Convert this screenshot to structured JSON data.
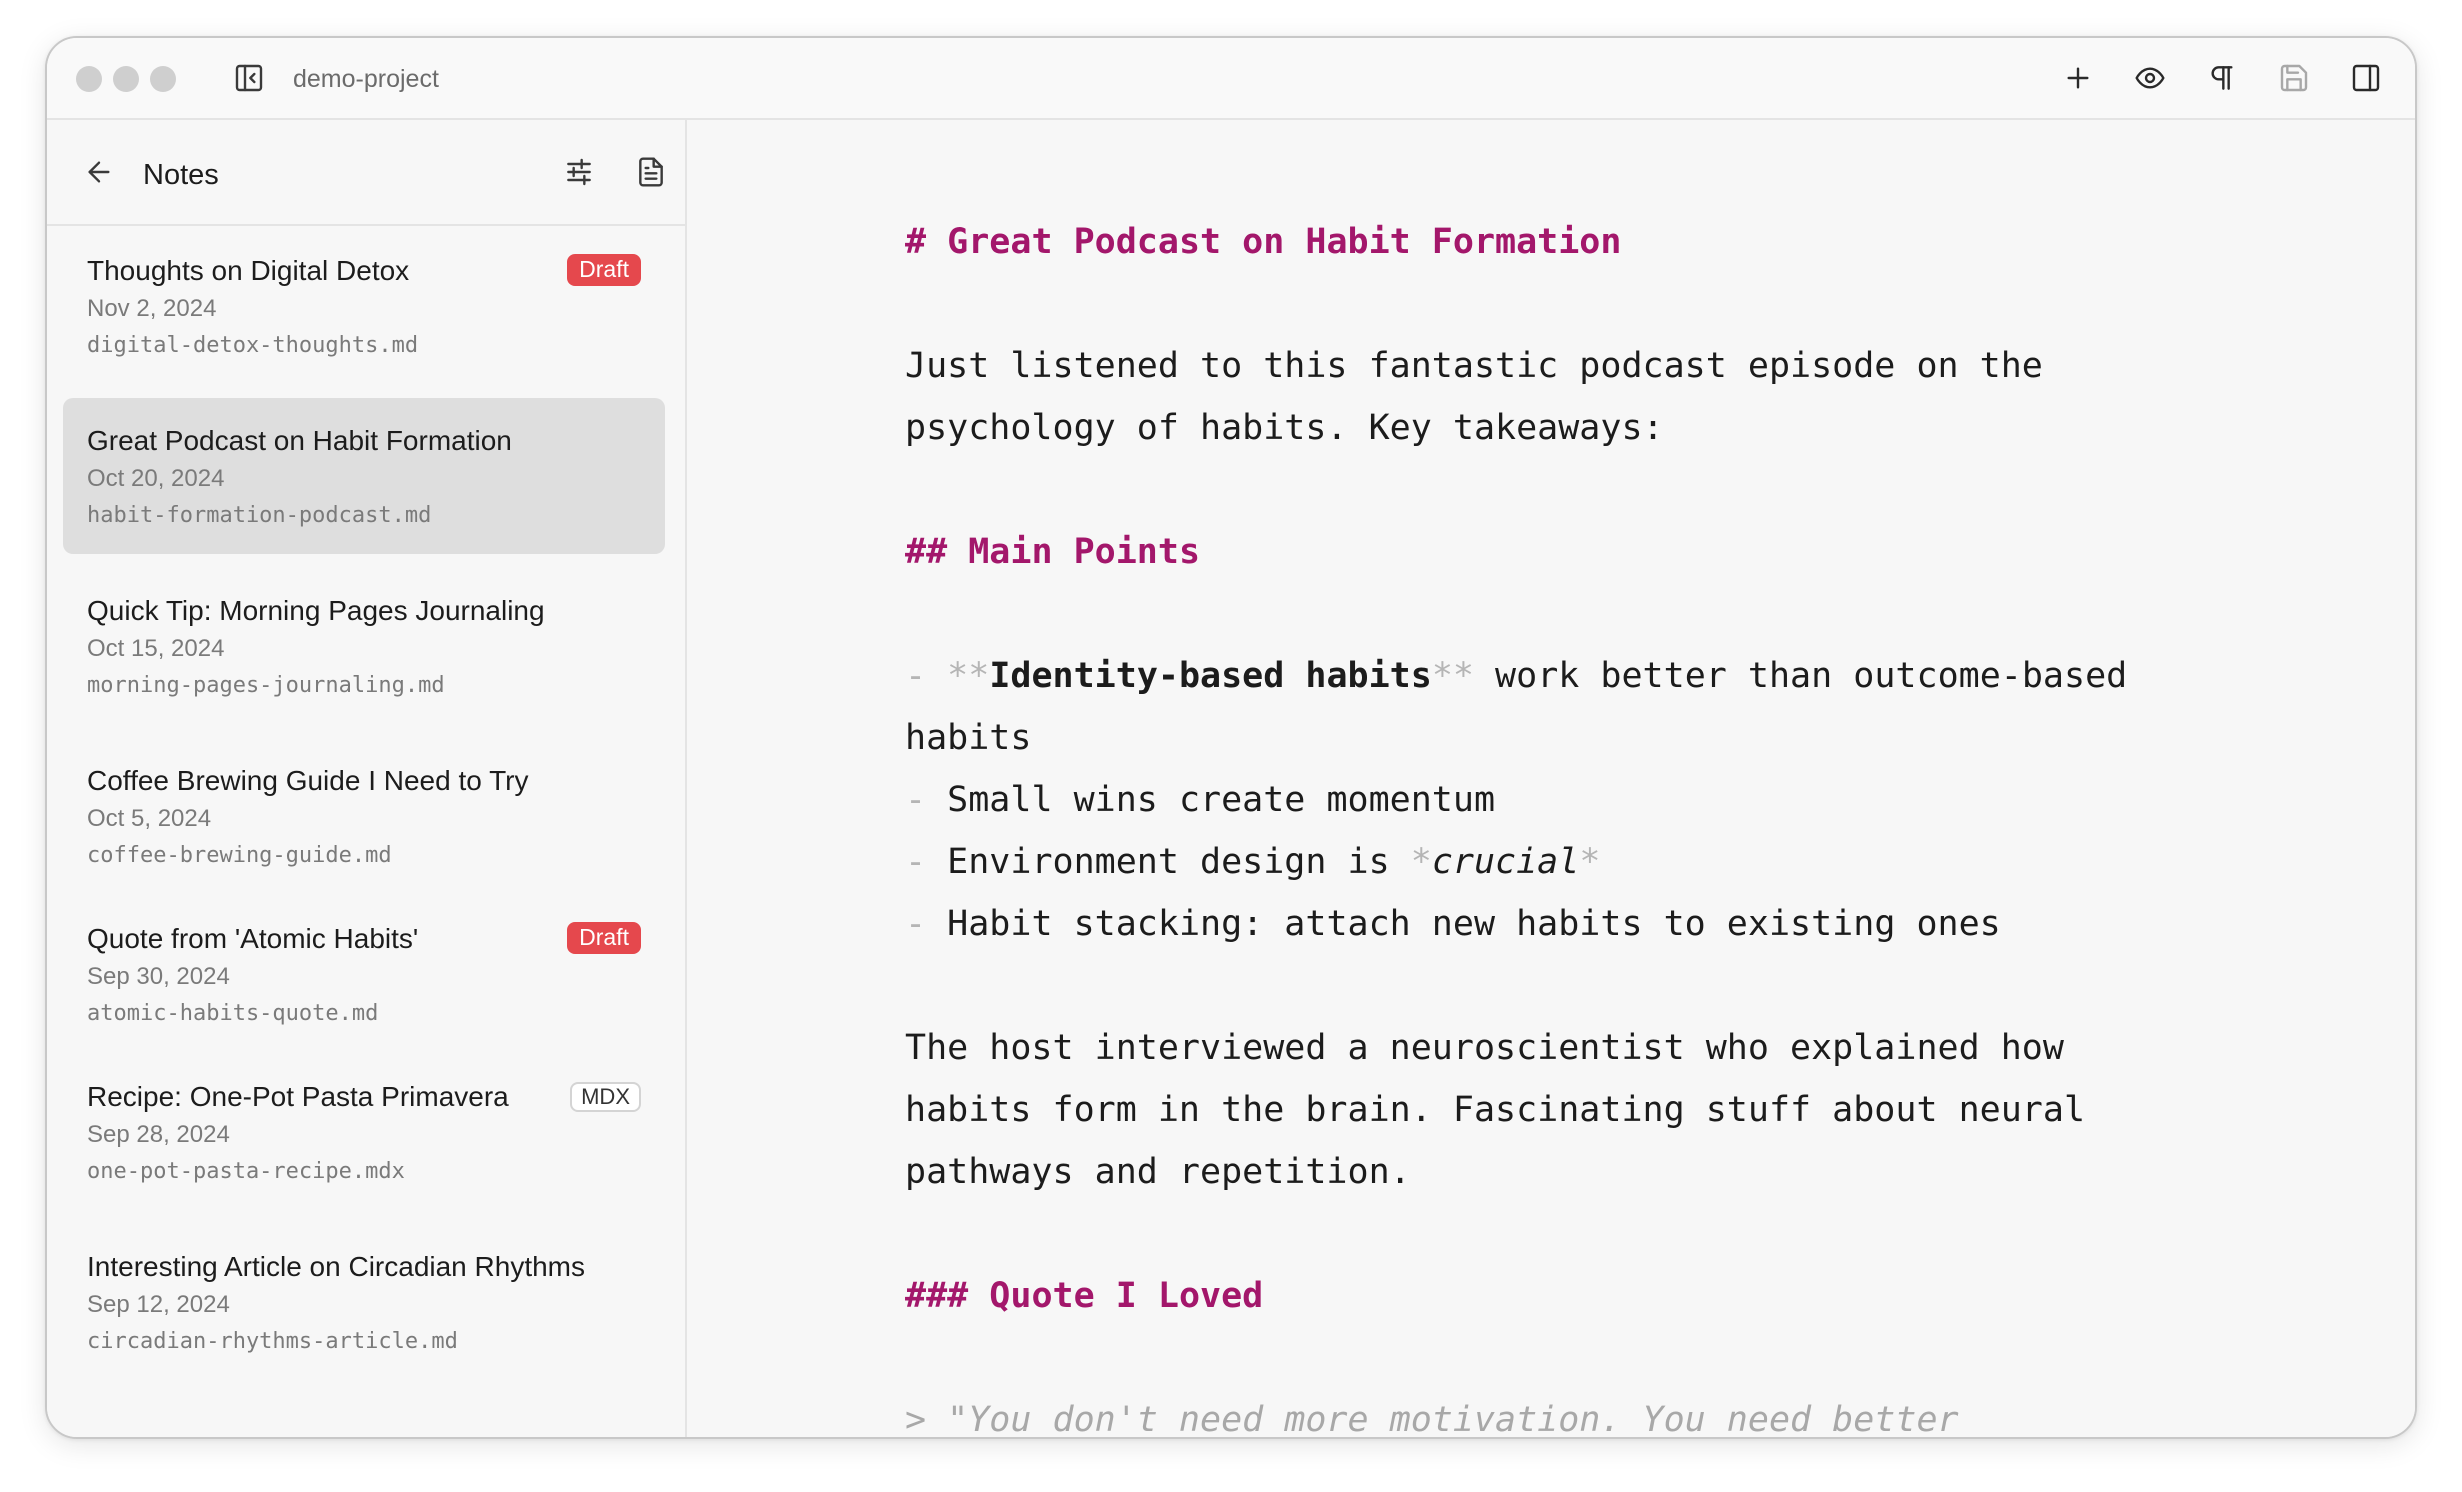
{
  "titlebar": {
    "project_name": "demo-project",
    "icons": [
      "sidebar-collapse-icon",
      "plus-icon",
      "eye-icon",
      "pilcrow-icon",
      "save-icon",
      "panel-right-icon"
    ]
  },
  "sidebar": {
    "title": "Notes",
    "icons": [
      "arrow-left-icon",
      "sliders-icon",
      "file-text-icon"
    ],
    "notes": [
      {
        "title": "Thoughts on Digital Detox",
        "date": "Nov 2, 2024",
        "file": "digital-detox-thoughts.md",
        "badge": "Draft"
      },
      {
        "title": "Great Podcast on Habit Formation",
        "date": "Oct 20, 2024",
        "file": "habit-formation-podcast.md",
        "badge": ""
      },
      {
        "title": "Quick Tip: Morning Pages Journaling",
        "date": "Oct 15, 2024",
        "file": "morning-pages-journaling.md",
        "badge": ""
      },
      {
        "title": "Coffee Brewing Guide I Need to Try",
        "date": "Oct 5, 2024",
        "file": "coffee-brewing-guide.md",
        "badge": ""
      },
      {
        "title": "Quote from 'Atomic Habits'",
        "date": "Sep 30, 2024",
        "file": "atomic-habits-quote.md",
        "badge": "Draft"
      },
      {
        "title": "Recipe: One-Pot Pasta Primavera",
        "date": "Sep 28, 2024",
        "file": "one-pot-pasta-recipe.mdx",
        "badge": "MDX"
      },
      {
        "title": "Interesting Article on Circadian Rhythms",
        "date": "Sep 12, 2024",
        "file": "circadian-rhythms-article.md",
        "badge": ""
      }
    ]
  },
  "editor": {
    "h1_marker": "#",
    "h1": "Great Podcast on Habit Formation",
    "para1_line1": "Just listened to this fantastic podcast episode on the",
    "para1_line2": "psychology of habits. Key takeaways:",
    "h2_marker": "##",
    "h2": "Main Points",
    "list_marker": "-",
    "bold_marker": "**",
    "item1_bold": "Identity-based habits",
    "item1_rest": " work better than outcome-based",
    "item1_cont": "habits",
    "item2": "Small wins create momentum",
    "item3_pre": "Environment design is ",
    "italic_marker": "*",
    "item3_italic": "crucial",
    "item4": "Habit stacking: attach new habits to existing ones",
    "para2_line1": "The host interviewed a neuroscientist who explained how",
    "para2_line2": "habits form in the brain. Fascinating stuff about neural",
    "para2_line3": "pathways and repetition.",
    "h3_marker": "###",
    "h3": "Quote I Loved",
    "quote_line1": "> \"You don't need more motivation. You need better"
  },
  "colors": {
    "heading": "#a3176b",
    "draft_badge": "#e5484d",
    "selected_row": "#dedede"
  }
}
